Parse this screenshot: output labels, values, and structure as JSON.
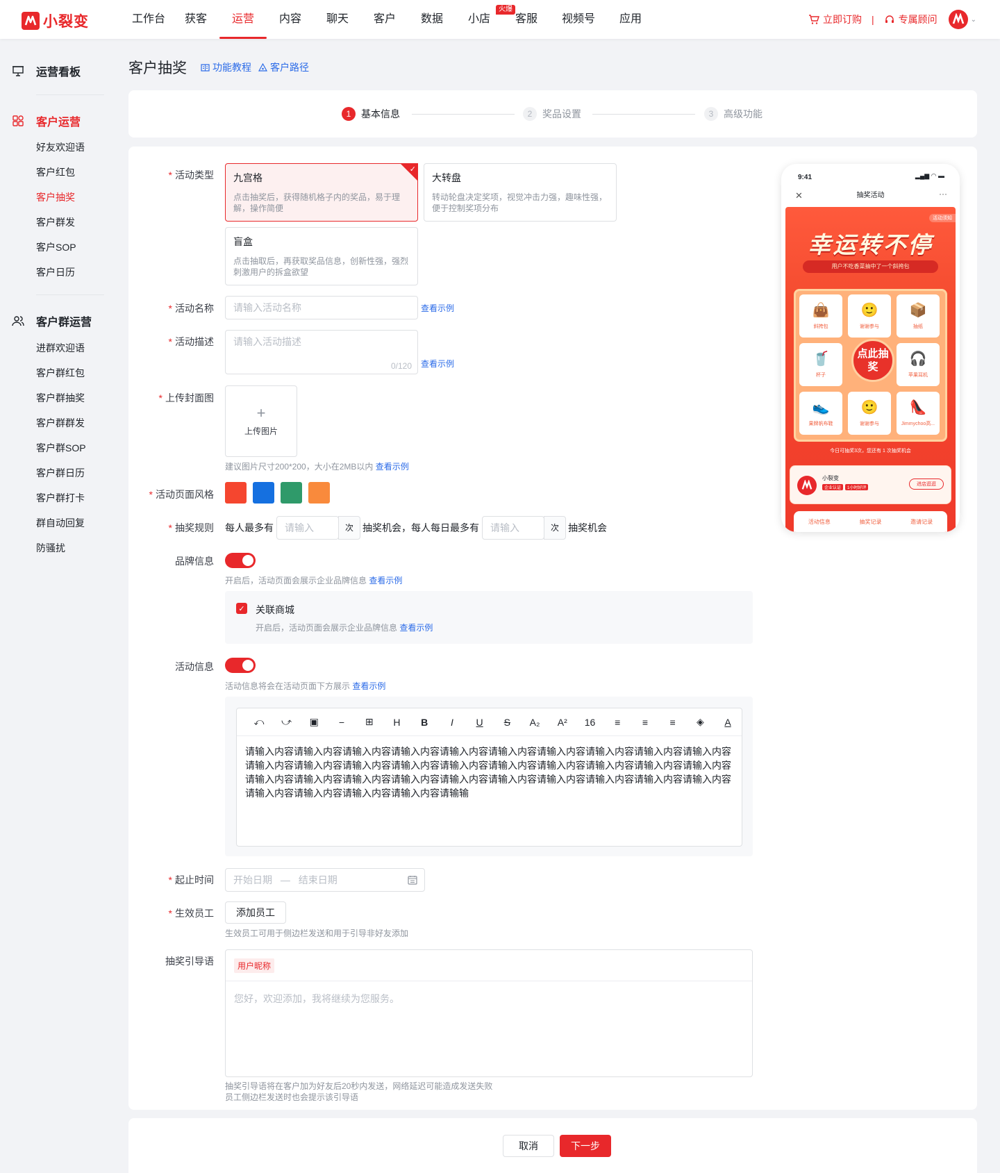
{
  "brand": {
    "name": "小裂变",
    "accent": "#e8282b"
  },
  "nav": {
    "items": [
      "工作台",
      "获客",
      "运营",
      "内容",
      "聊天",
      "客户",
      "数据",
      "小店",
      "客服",
      "视频号",
      "应用"
    ],
    "active": "运营",
    "hot_badge": "火爆"
  },
  "top_right": {
    "order": "立即订购",
    "sep": "|",
    "advisor": "专属顾问"
  },
  "sidebar": {
    "dashboard": "运营看板",
    "group1": {
      "title": "客户运营",
      "items": [
        "好友欢迎语",
        "客户红包",
        "客户抽奖",
        "客户群发",
        "客户SOP",
        "客户日历"
      ],
      "active": "客户抽奖"
    },
    "group2": {
      "title": "客户群运营",
      "items": [
        "进群欢迎语",
        "客户群红包",
        "客户群抽奖",
        "客户群群发",
        "客户群SOP",
        "客户群日历",
        "客户群打卡",
        "群自动回复",
        "防骚扰"
      ]
    }
  },
  "page": {
    "title": "客户抽奖",
    "link_tutorial": "功能教程",
    "link_path": "客户路径"
  },
  "steps": [
    {
      "num": "1",
      "label": "基本信息"
    },
    {
      "num": "2",
      "label": "奖品设置"
    },
    {
      "num": "3",
      "label": "高级功能"
    }
  ],
  "form": {
    "activity_type": {
      "label": "活动类型",
      "options": [
        {
          "title": "九宫格",
          "desc": "点击抽奖后，获得随机格子内的奖品，易于理解，操作简便"
        },
        {
          "title": "大转盘",
          "desc": "转动轮盘决定奖项，视觉冲击力强，趣味性强，便于控制奖项分布"
        },
        {
          "title": "盲盒",
          "desc": "点击抽取后，再获取奖品信息，创新性强，强烈刺激用户的拆盒欲望"
        }
      ],
      "selected": "九宫格"
    },
    "name": {
      "label": "活动名称",
      "placeholder": "请输入活动名称",
      "example": "查看示例"
    },
    "desc": {
      "label": "活动描述",
      "placeholder": "请输入活动描述",
      "counter": "0/120",
      "example": "查看示例"
    },
    "cover": {
      "label": "上传封面图",
      "upload": "上传图片",
      "hint": "建议图片尺寸200*200，大小在2MB以内",
      "example": "查看示例"
    },
    "style": {
      "label": "活动页面风格",
      "colors": [
        "#f5462f",
        "#1570e0",
        "#2f9a6a",
        "#f98a3c"
      ]
    },
    "rule": {
      "label": "抽奖规则",
      "t1": "每人最多有",
      "ph": "请输入",
      "unit": "次",
      "t2": "抽奖机会，每人每日最多有",
      "t3": "抽奖机会"
    },
    "brand": {
      "label": "品牌信息",
      "hint": "开启后，活动页面会展示企业品牌信息",
      "example": "查看示例",
      "mall_label": "关联商城",
      "mall_hint": "开启后，活动页面会展示企业品牌信息",
      "mall_example": "查看示例"
    },
    "info": {
      "label": "活动信息",
      "hint": "活动信息将会在活动页面下方展示",
      "example": "查看示例",
      "toolbar": [
        "⤺",
        "⤻",
        "▣",
        "−",
        "⊞",
        "H",
        "B",
        "I",
        "U",
        "S",
        "A₂",
        "A²",
        "16",
        "≡",
        "≡",
        "≡",
        "◈",
        "A"
      ],
      "content": "请输入内容请输入内容请输入内容请输入内容请输入内容请输入内容请输入内容请输入内容请输入内容请输入内容请输入内容请输入内容请输入内容请输入内容请输入内容请输入内容请输入内容请输入内容请输入内容请输入内容请输入内容请输入内容请输入内容请输入内容请输入内容请输入内容请输入内容请输入内容请输入内容请输入内容请输入内容请输入内容请输入内容请输入内容请输输"
    },
    "time": {
      "label": "起止时间",
      "start": "开始日期",
      "dash": "—",
      "end": "结束日期"
    },
    "staff": {
      "label": "生效员工",
      "button": "添加员工",
      "hint": "生效员工可用于侧边栏发送和用于引导非好友添加"
    },
    "guide": {
      "label": "抽奖引导语",
      "tag": "用户昵称",
      "placeholder": "您好，欢迎添加，我将继续为您服务。",
      "hint1": "抽奖引导语将在客户加为好友后20秒内发送，网络延迟可能造成发送失败",
      "hint2": "员工侧边栏发送时也会提示该引导语"
    }
  },
  "footer": {
    "cancel": "取消",
    "next": "下一步"
  },
  "preview": {
    "time": "9:41",
    "nav_title": "抽奖活动",
    "rule_tag": "活动须知",
    "headline": "幸运转不停",
    "marquee": "用户不吃香菜抽中了一个斜挎包",
    "prizes": [
      "斜挎包",
      "谢谢参与",
      "抽纸",
      "杯子",
      "苹果耳机",
      "果牌帆布鞋",
      "谢谢参与",
      "Jimmychoo高..."
    ],
    "center": "点此抽奖",
    "remain": "今日可抽奖3次，您还有 1 次抽奖机会",
    "shop_name": "小裂变",
    "shop_tags": [
      "企业认证",
      "1小时好评"
    ],
    "shop_btn": "进店逛逛",
    "tabs": [
      "活动信息",
      "抽奖记录",
      "邀请记录"
    ]
  }
}
